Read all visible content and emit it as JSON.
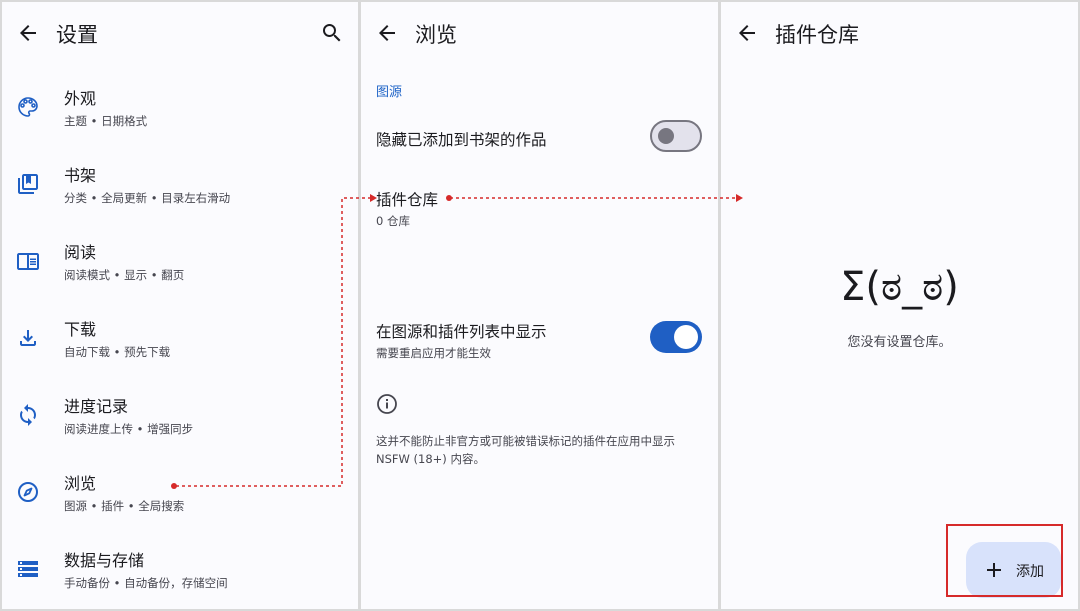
{
  "settings": {
    "title": "设置",
    "items": [
      {
        "title": "外观",
        "subtitle": "主题 • 日期格式",
        "icon": "palette-icon"
      },
      {
        "title": "书架",
        "subtitle": "分类 • 全局更新 • 目录左右滑动",
        "icon": "library-icon"
      },
      {
        "title": "阅读",
        "subtitle": "阅读模式 • 显示 • 翻页",
        "icon": "book-open-icon"
      },
      {
        "title": "下载",
        "subtitle": "自动下载 • 预先下载",
        "icon": "download-icon"
      },
      {
        "title": "进度记录",
        "subtitle": "阅读进度上传 • 增强同步",
        "icon": "sync-icon"
      },
      {
        "title": "浏览",
        "subtitle": "图源 • 插件 • 全局搜索",
        "icon": "compass-icon"
      },
      {
        "title": "数据与存储",
        "subtitle": "手动备份 • 自动备份，存储空间",
        "icon": "storage-icon"
      }
    ]
  },
  "browse": {
    "title": "浏览",
    "section_header": "图源",
    "hide_in_library": {
      "title": "隐藏已添加到书架的作品",
      "enabled": false
    },
    "extension_repos": {
      "title": "插件仓库",
      "subtitle": "0 仓库"
    },
    "show_nsfw": {
      "title": "在图源和插件列表中显示",
      "subtitle": "需要重启应用才能生效",
      "enabled": true
    },
    "info_text": "这并不能防止非官方或可能被错误标记的插件在应用中显示 NSFW (18+) 内容。"
  },
  "repo": {
    "title": "插件仓库",
    "face": "Σ(ಠ_ಠ)",
    "empty_message": "您没有设置仓库。",
    "add_label": "添加"
  },
  "colors": {
    "accent": "#1f5fc4",
    "annotation": "#d62a2a",
    "fab_bg": "#d8e2fb",
    "panel_bg": "#fbfbfe"
  }
}
